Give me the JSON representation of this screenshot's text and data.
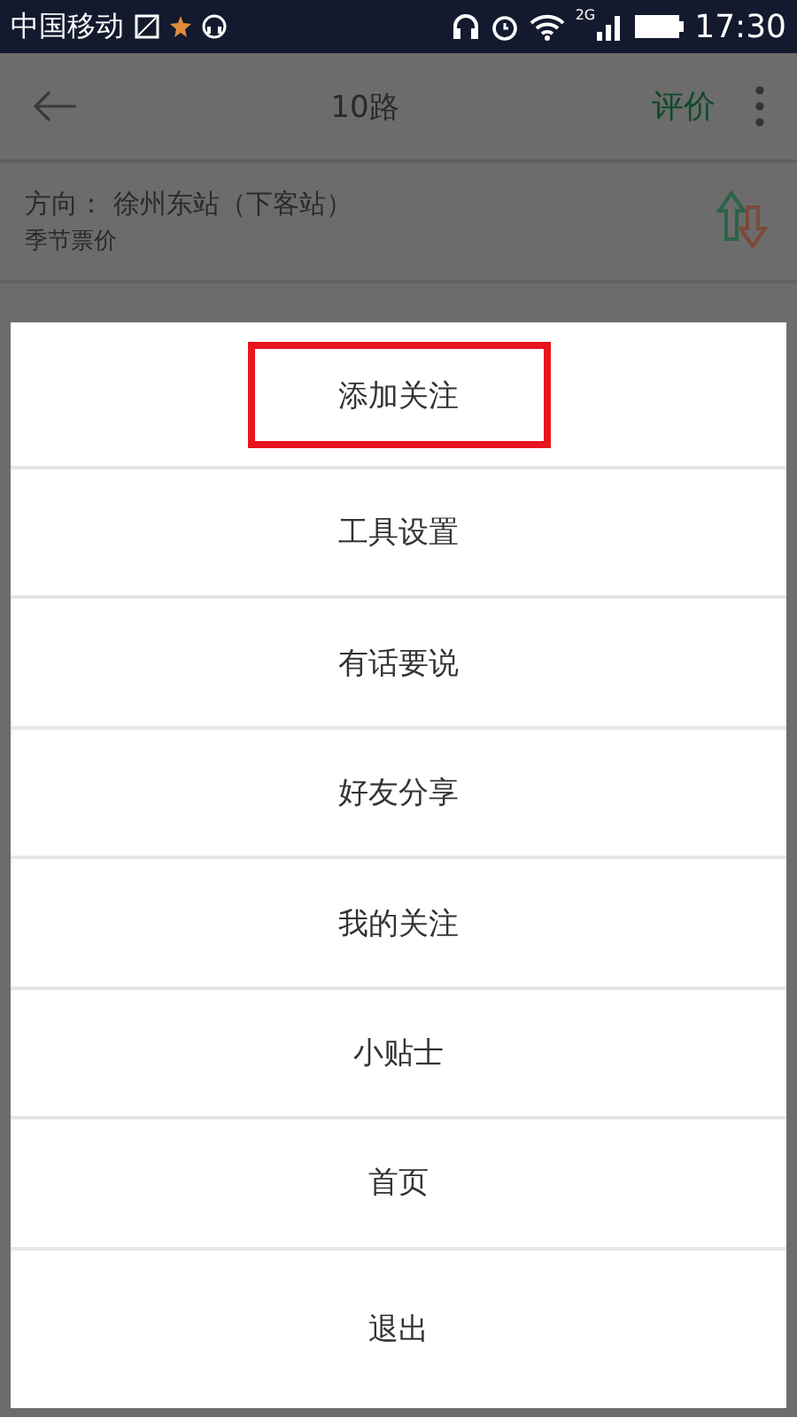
{
  "status_bar": {
    "carrier": "中国移动",
    "network": "2G",
    "time": "17:30"
  },
  "header": {
    "title": "10路",
    "action": "评价"
  },
  "route_info": {
    "direction_label": "方向：",
    "direction": "徐州东站（下客站）",
    "note": "季节票价"
  },
  "menu": {
    "items": [
      {
        "label": "添加关注",
        "highlighted": true
      },
      {
        "label": "工具设置",
        "highlighted": false
      },
      {
        "label": "有话要说",
        "highlighted": false
      },
      {
        "label": "好友分享",
        "highlighted": false
      },
      {
        "label": "我的关注",
        "highlighted": false
      },
      {
        "label": "小贴士",
        "highlighted": false
      },
      {
        "label": "首页",
        "highlighted": false
      },
      {
        "label": "退出",
        "highlighted": false
      }
    ]
  }
}
